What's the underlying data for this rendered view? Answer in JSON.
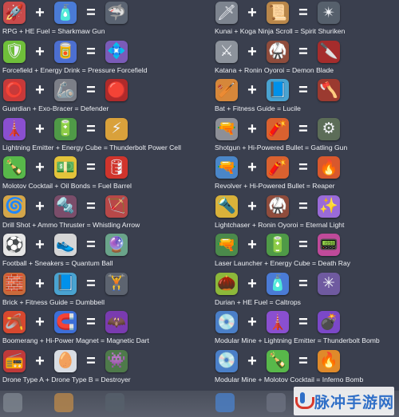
{
  "colors": {
    "background": "#3a3f4e",
    "watermark_text": "#2f6fc7",
    "watermark_accent": "#d83a2d"
  },
  "operators": {
    "plus": "+",
    "equals": "="
  },
  "left_recipes": [
    {
      "label": "RPG + HE Fuel = Sharkmaw Gun",
      "a": {
        "icon": "rocket-icon",
        "glyph": "🚀",
        "color": "#c94b4b"
      },
      "b": {
        "icon": "fuel-canister-icon",
        "glyph": "🧴",
        "color": "#4a7bd6"
      },
      "c": {
        "icon": "shark-gun-icon",
        "glyph": "🦈",
        "color": "#5b6472"
      }
    },
    {
      "label": "Forcefield + Energy Drink = Pressure Forcefield",
      "a": {
        "icon": "forcefield-icon",
        "glyph": "🛡",
        "color": "#6fbf3a"
      },
      "b": {
        "icon": "energy-drink-icon",
        "glyph": "🥫",
        "color": "#4c6fd1"
      },
      "c": {
        "icon": "pressure-forcefield-icon",
        "glyph": "💠",
        "color": "#7a5bb8"
      }
    },
    {
      "label": "Guardian + Exo-Bracer = Defender",
      "a": {
        "icon": "guardian-icon",
        "glyph": "⭕",
        "color": "#c73a3a"
      },
      "b": {
        "icon": "exo-bracer-icon",
        "glyph": "🦾",
        "color": "#7c7f88"
      },
      "c": {
        "icon": "defender-icon",
        "glyph": "🔴",
        "color": "#b02a2a"
      }
    },
    {
      "label": "Lightning Emitter + Energy Cube = Thunderbolt Power Cell",
      "a": {
        "icon": "lightning-emitter-icon",
        "glyph": "🗼",
        "color": "#8a4fd0"
      },
      "b": {
        "icon": "energy-cube-icon",
        "glyph": "🔋",
        "color": "#4f9a47"
      },
      "c": {
        "icon": "power-cell-icon",
        "glyph": "⚡",
        "color": "#d9a13b"
      }
    },
    {
      "label": "Molotov Cocktail + Oil Bonds = Fuel Barrel",
      "a": {
        "icon": "molotov-icon",
        "glyph": "🍾",
        "color": "#58b84a"
      },
      "b": {
        "icon": "oil-bonds-icon",
        "glyph": "💵",
        "color": "#e3c33a"
      },
      "c": {
        "icon": "fuel-barrel-icon",
        "glyph": "🛢",
        "color": "#d0342c"
      }
    },
    {
      "label": "Drill Shot + Ammo Thruster = Whistling Arrow",
      "a": {
        "icon": "drill-shot-icon",
        "glyph": "🌀",
        "color": "#d4a64a"
      },
      "b": {
        "icon": "ammo-thruster-icon",
        "glyph": "🔩",
        "color": "#7a4d6a"
      },
      "c": {
        "icon": "whistling-arrow-icon",
        "glyph": "🏹",
        "color": "#b84848"
      }
    },
    {
      "label": "Football + Sneakers = Quantum Ball",
      "a": {
        "icon": "football-icon",
        "glyph": "⚽",
        "color": "#e6e6e6"
      },
      "b": {
        "icon": "sneakers-icon",
        "glyph": "👟",
        "color": "#d6d6d6"
      },
      "c": {
        "icon": "quantum-ball-icon",
        "glyph": "🔮",
        "color": "#6aa48a"
      }
    },
    {
      "label": "Brick + Fitness Guide = Dumbbell",
      "a": {
        "icon": "brick-icon",
        "glyph": "🧱",
        "color": "#c96a3b"
      },
      "b": {
        "icon": "fitness-guide-icon",
        "glyph": "📘",
        "color": "#4aa3d0"
      },
      "c": {
        "icon": "dumbbell-icon",
        "glyph": "🏋",
        "color": "#5d6470"
      }
    },
    {
      "label": "Boomerang + Hi-Power Magnet = Magnetic Dart",
      "a": {
        "icon": "boomerang-icon",
        "glyph": "🪃",
        "color": "#d7482f"
      },
      "b": {
        "icon": "magnet-icon",
        "glyph": "🧲",
        "color": "#3d6fd8"
      },
      "c": {
        "icon": "magnetic-dart-icon",
        "glyph": "🦇",
        "color": "#7a3bb0"
      }
    },
    {
      "label": "Drone Type A + Drone Type B = Destroyer",
      "a": {
        "icon": "drone-a-icon",
        "glyph": "📻",
        "color": "#c03a3a"
      },
      "b": {
        "icon": "drone-b-icon",
        "glyph": "🥚",
        "color": "#d9dde3"
      },
      "c": {
        "icon": "destroyer-icon",
        "glyph": "👾",
        "color": "#4e7a4a"
      }
    }
  ],
  "right_recipes": [
    {
      "label": "Kunai + Koga Ninja Scroll = Spirit Shuriken",
      "a": {
        "icon": "kunai-icon",
        "glyph": "🗡",
        "color": "#7d848f"
      },
      "b": {
        "icon": "ninja-scroll-icon",
        "glyph": "📜",
        "color": "#b9874a"
      },
      "c": {
        "icon": "shuriken-icon",
        "glyph": "✴",
        "color": "#56606c"
      }
    },
    {
      "label": "Katana + Ronin Oyoroi = Demon Blade",
      "a": {
        "icon": "katana-icon",
        "glyph": "⚔",
        "color": "#8d939c"
      },
      "b": {
        "icon": "ronin-armor-icon",
        "glyph": "🥋",
        "color": "#8f4c3c"
      },
      "c": {
        "icon": "demon-blade-icon",
        "glyph": "🔪",
        "color": "#a52c2c"
      }
    },
    {
      "label": "Bat + Fitness Guide = Lucile",
      "a": {
        "icon": "bat-icon",
        "glyph": "🏏",
        "color": "#d6873a"
      },
      "b": {
        "icon": "fitness-guide-icon",
        "glyph": "📘",
        "color": "#4aa3d0"
      },
      "c": {
        "icon": "lucile-icon",
        "glyph": "🪓",
        "color": "#9b3a30"
      }
    },
    {
      "label": "Shotgun + Hi-Powered Bullet = Gatling Gun",
      "a": {
        "icon": "shotgun-icon",
        "glyph": "🔫",
        "color": "#8d8f97"
      },
      "b": {
        "icon": "bullet-icon",
        "glyph": "🧨",
        "color": "#d9612f"
      },
      "c": {
        "icon": "gatling-gun-icon",
        "glyph": "⚙",
        "color": "#5c6d58"
      }
    },
    {
      "label": "Revolver + Hi-Powered Bullet = Reaper",
      "a": {
        "icon": "revolver-icon",
        "glyph": "🔫",
        "color": "#4a86c8"
      },
      "b": {
        "icon": "bullet-icon",
        "glyph": "🧨",
        "color": "#d9612f"
      },
      "c": {
        "icon": "reaper-icon",
        "glyph": "🔥",
        "color": "#d8582d"
      }
    },
    {
      "label": "Lightchaser + Ronin Oyoroi = Eternal Light",
      "a": {
        "icon": "lightchaser-icon",
        "glyph": "🔦",
        "color": "#d9b23a"
      },
      "b": {
        "icon": "ronin-armor-icon",
        "glyph": "🥋",
        "color": "#8f4c3c"
      },
      "c": {
        "icon": "eternal-light-icon",
        "glyph": "✨",
        "color": "#9a6bd8"
      }
    },
    {
      "label": "Laser Launcher + Energy Cube = Death Ray",
      "a": {
        "icon": "laser-launcher-icon",
        "glyph": "🔫",
        "color": "#4b8a4b"
      },
      "b": {
        "icon": "energy-cube-icon",
        "glyph": "🔋",
        "color": "#4f9a47"
      },
      "c": {
        "icon": "death-ray-icon",
        "glyph": "📟",
        "color": "#c04a9a"
      }
    },
    {
      "label": "Durian + HE Fuel = Caltrops",
      "a": {
        "icon": "durian-icon",
        "glyph": "🌰",
        "color": "#8db83a"
      },
      "b": {
        "icon": "fuel-canister-icon",
        "glyph": "🧴",
        "color": "#4a7bd6"
      },
      "c": {
        "icon": "caltrops-icon",
        "glyph": "✳",
        "color": "#6f5aa0"
      }
    },
    {
      "label": "Modular Mine + Lightning Emitter = Thunderbolt Bomb",
      "a": {
        "icon": "modular-mine-icon",
        "glyph": "💿",
        "color": "#4a7fc8"
      },
      "b": {
        "icon": "lightning-emitter-icon",
        "glyph": "🗼",
        "color": "#8a4fd0"
      },
      "c": {
        "icon": "thunderbolt-bomb-icon",
        "glyph": "💣",
        "color": "#7b48c8"
      }
    },
    {
      "label": "Modular Mine + Molotov Cocktail = Inferno Bomb",
      "a": {
        "icon": "modular-mine-icon",
        "glyph": "💿",
        "color": "#4a7fc8"
      },
      "b": {
        "icon": "molotov-icon",
        "glyph": "🍾",
        "color": "#58b84a"
      },
      "c": {
        "icon": "inferno-bomb-icon",
        "glyph": "🔥",
        "color": "#e08a2a"
      }
    }
  ],
  "bottom_strip": [
    {
      "icon": "kunai-faded-icon",
      "color": "#7d848f"
    },
    {
      "icon": "scroll-faded-icon",
      "color": "#b9874a"
    },
    {
      "icon": "shuriken-faded-icon",
      "color": "#56606c"
    },
    {
      "icon": "mine-faded-icon",
      "color": "#4a7fc8"
    },
    {
      "icon": "rune-faded-icon",
      "color": "#6b7180"
    }
  ],
  "watermark": {
    "text": "脉冲手游网"
  }
}
